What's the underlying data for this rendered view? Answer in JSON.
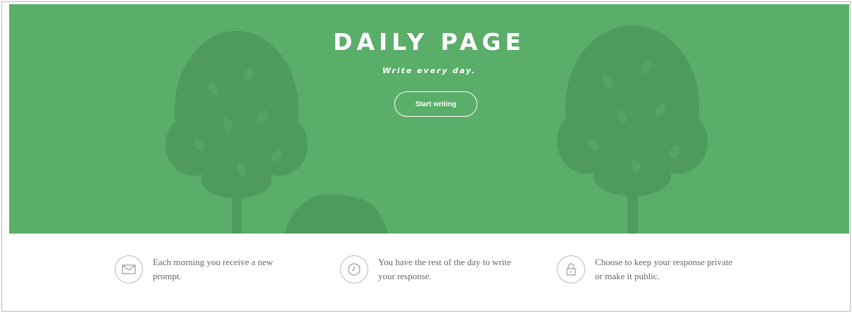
{
  "hero": {
    "title": "DAILY PAGE",
    "tagline": "Write every day.",
    "cta_label": "Start writing",
    "background_color": "#5bad6a",
    "tree_color": "#4f9a5d"
  },
  "features": [
    {
      "icon": "envelope-icon",
      "text": "Each morning you receive a new prompt."
    },
    {
      "icon": "clock-icon",
      "text": "You have the rest of the day to write your response."
    },
    {
      "icon": "lock-icon",
      "text": "Choose to keep your response private or make it public."
    }
  ]
}
